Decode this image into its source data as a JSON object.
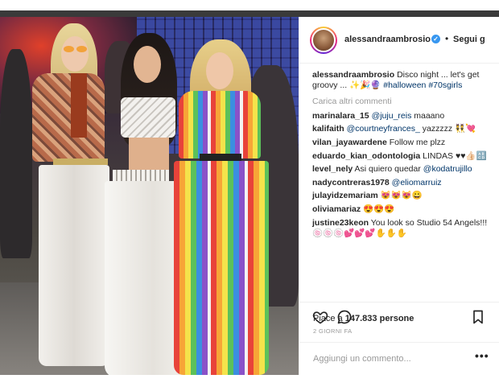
{
  "post": {
    "username": "alessandraambrosio",
    "follow_label": "Segui g",
    "caption_user": "alessandraambrosio",
    "caption_text": "Disco night ... let's get groovy ... ✨🎉🔮",
    "caption_tags": [
      "#halloween",
      "#70sgirls"
    ],
    "load_more": "Carica altri commenti",
    "likes_prefix": "Piace a",
    "likes_count": "147.833",
    "likes_suffix": "persone",
    "date": "2 GIORNI FA",
    "add_comment_placeholder": "Aggiungi un commento...",
    "more_label": "•••"
  },
  "comments": [
    {
      "user": "marinalara_15",
      "mention": "@juju_reis",
      "text": "maaano"
    },
    {
      "user": "kalifaith",
      "mention": "@courtneyfrances_",
      "text": "yazzzzz 👯💘"
    },
    {
      "user": "vilan_jayawardene",
      "mention": "",
      "text": "Follow me plzz"
    },
    {
      "user": "eduardo_kian_odontologia",
      "mention": "",
      "text": "LINDAS ♥♥👍🏻🔠"
    },
    {
      "user": "level_nely",
      "mention": "",
      "text": "Asi quiero quedar",
      "mention_after": "@kodatrujillo"
    },
    {
      "user": "nadycontreras1978",
      "mention": "@eliomarruiz",
      "text": ""
    },
    {
      "user": "julayidzemariam",
      "mention": "",
      "text": "😻😻😻😀"
    },
    {
      "user": "oliviamariaz",
      "mention": "",
      "text": "😍😍😍"
    },
    {
      "user": "justine23keon",
      "mention": "",
      "text": "You look so Studio 54 Angels!!! 🍥🍥🍥💕💕💕✋✋✋"
    }
  ],
  "icons": {
    "like": "heart-icon",
    "comment": "comment-bubble-icon",
    "save": "bookmark-icon",
    "verified": "verified-badge-icon"
  },
  "colors": {
    "link": "#003569",
    "muted": "#999999",
    "verified": "#3897f0"
  }
}
